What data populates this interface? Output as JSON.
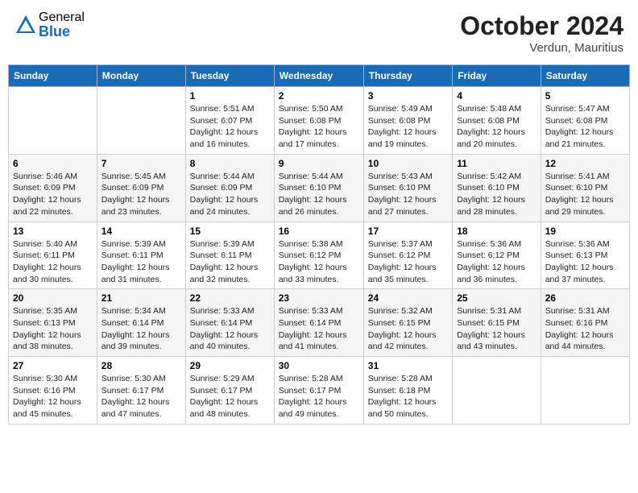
{
  "header": {
    "logo_general": "General",
    "logo_blue": "Blue",
    "month_title": "October 2024",
    "subtitle": "Verdun, Mauritius"
  },
  "days_of_week": [
    "Sunday",
    "Monday",
    "Tuesday",
    "Wednesday",
    "Thursday",
    "Friday",
    "Saturday"
  ],
  "weeks": [
    [
      {
        "day": "",
        "detail": ""
      },
      {
        "day": "",
        "detail": ""
      },
      {
        "day": "1",
        "detail": "Sunrise: 5:51 AM\nSunset: 6:07 PM\nDaylight: 12 hours and 16 minutes."
      },
      {
        "day": "2",
        "detail": "Sunrise: 5:50 AM\nSunset: 6:08 PM\nDaylight: 12 hours and 17 minutes."
      },
      {
        "day": "3",
        "detail": "Sunrise: 5:49 AM\nSunset: 6:08 PM\nDaylight: 12 hours and 19 minutes."
      },
      {
        "day": "4",
        "detail": "Sunrise: 5:48 AM\nSunset: 6:08 PM\nDaylight: 12 hours and 20 minutes."
      },
      {
        "day": "5",
        "detail": "Sunrise: 5:47 AM\nSunset: 6:08 PM\nDaylight: 12 hours and 21 minutes."
      }
    ],
    [
      {
        "day": "6",
        "detail": "Sunrise: 5:46 AM\nSunset: 6:09 PM\nDaylight: 12 hours and 22 minutes."
      },
      {
        "day": "7",
        "detail": "Sunrise: 5:45 AM\nSunset: 6:09 PM\nDaylight: 12 hours and 23 minutes."
      },
      {
        "day": "8",
        "detail": "Sunrise: 5:44 AM\nSunset: 6:09 PM\nDaylight: 12 hours and 24 minutes."
      },
      {
        "day": "9",
        "detail": "Sunrise: 5:44 AM\nSunset: 6:10 PM\nDaylight: 12 hours and 26 minutes."
      },
      {
        "day": "10",
        "detail": "Sunrise: 5:43 AM\nSunset: 6:10 PM\nDaylight: 12 hours and 27 minutes."
      },
      {
        "day": "11",
        "detail": "Sunrise: 5:42 AM\nSunset: 6:10 PM\nDaylight: 12 hours and 28 minutes."
      },
      {
        "day": "12",
        "detail": "Sunrise: 5:41 AM\nSunset: 6:10 PM\nDaylight: 12 hours and 29 minutes."
      }
    ],
    [
      {
        "day": "13",
        "detail": "Sunrise: 5:40 AM\nSunset: 6:11 PM\nDaylight: 12 hours and 30 minutes."
      },
      {
        "day": "14",
        "detail": "Sunrise: 5:39 AM\nSunset: 6:11 PM\nDaylight: 12 hours and 31 minutes."
      },
      {
        "day": "15",
        "detail": "Sunrise: 5:39 AM\nSunset: 6:11 PM\nDaylight: 12 hours and 32 minutes."
      },
      {
        "day": "16",
        "detail": "Sunrise: 5:38 AM\nSunset: 6:12 PM\nDaylight: 12 hours and 33 minutes."
      },
      {
        "day": "17",
        "detail": "Sunrise: 5:37 AM\nSunset: 6:12 PM\nDaylight: 12 hours and 35 minutes."
      },
      {
        "day": "18",
        "detail": "Sunrise: 5:36 AM\nSunset: 6:12 PM\nDaylight: 12 hours and 36 minutes."
      },
      {
        "day": "19",
        "detail": "Sunrise: 5:36 AM\nSunset: 6:13 PM\nDaylight: 12 hours and 37 minutes."
      }
    ],
    [
      {
        "day": "20",
        "detail": "Sunrise: 5:35 AM\nSunset: 6:13 PM\nDaylight: 12 hours and 38 minutes."
      },
      {
        "day": "21",
        "detail": "Sunrise: 5:34 AM\nSunset: 6:14 PM\nDaylight: 12 hours and 39 minutes."
      },
      {
        "day": "22",
        "detail": "Sunrise: 5:33 AM\nSunset: 6:14 PM\nDaylight: 12 hours and 40 minutes."
      },
      {
        "day": "23",
        "detail": "Sunrise: 5:33 AM\nSunset: 6:14 PM\nDaylight: 12 hours and 41 minutes."
      },
      {
        "day": "24",
        "detail": "Sunrise: 5:32 AM\nSunset: 6:15 PM\nDaylight: 12 hours and 42 minutes."
      },
      {
        "day": "25",
        "detail": "Sunrise: 5:31 AM\nSunset: 6:15 PM\nDaylight: 12 hours and 43 minutes."
      },
      {
        "day": "26",
        "detail": "Sunrise: 5:31 AM\nSunset: 6:16 PM\nDaylight: 12 hours and 44 minutes."
      }
    ],
    [
      {
        "day": "27",
        "detail": "Sunrise: 5:30 AM\nSunset: 6:16 PM\nDaylight: 12 hours and 45 minutes."
      },
      {
        "day": "28",
        "detail": "Sunrise: 5:30 AM\nSunset: 6:17 PM\nDaylight: 12 hours and 47 minutes."
      },
      {
        "day": "29",
        "detail": "Sunrise: 5:29 AM\nSunset: 6:17 PM\nDaylight: 12 hours and 48 minutes."
      },
      {
        "day": "30",
        "detail": "Sunrise: 5:28 AM\nSunset: 6:17 PM\nDaylight: 12 hours and 49 minutes."
      },
      {
        "day": "31",
        "detail": "Sunrise: 5:28 AM\nSunset: 6:18 PM\nDaylight: 12 hours and 50 minutes."
      },
      {
        "day": "",
        "detail": ""
      },
      {
        "day": "",
        "detail": ""
      }
    ]
  ]
}
